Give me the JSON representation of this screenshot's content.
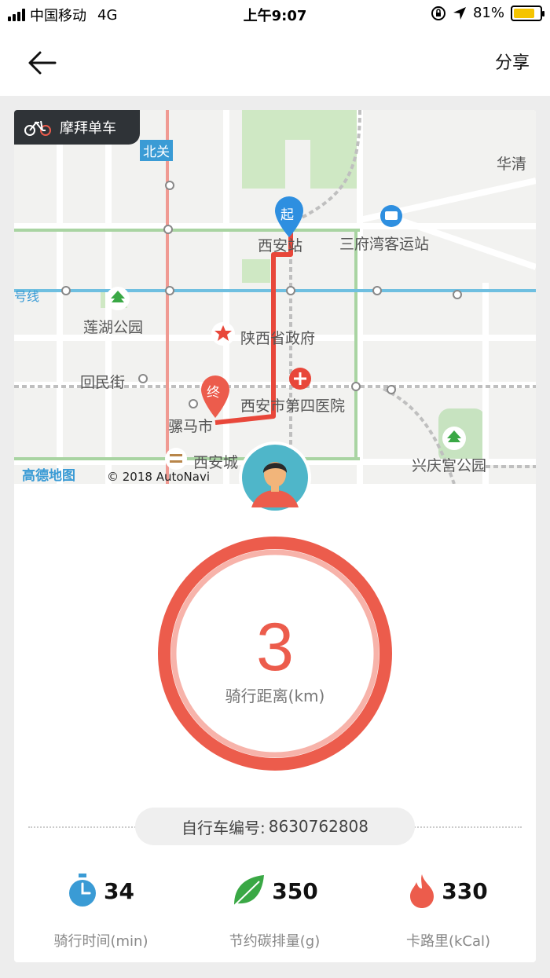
{
  "status_bar": {
    "carrier": "中国移动",
    "network": "4G",
    "time": "上午9:07",
    "battery": "81%",
    "battery_level": 0.81
  },
  "nav": {
    "share_label": "分享"
  },
  "map": {
    "brand": "摩拜单车",
    "labels": {
      "beiguan": "北关",
      "huaqing": "华清",
      "xian_station": "西安站",
      "sanfu": "三府湾客运站",
      "line_suffix": "号线",
      "lianhu": "莲湖公园",
      "shaanxi_gov": "陕西省政府",
      "huimin": "回民街",
      "hospital": "西安市第四医院",
      "luomashi": "骡马市",
      "xian_cheng": "西安城",
      "xingqing": "兴庆宫公园",
      "start_marker": "起",
      "end_marker": "终"
    },
    "amap_logo": "高德地图",
    "copyright": "© 2018 AutoNavi"
  },
  "ride": {
    "distance": "3",
    "distance_label": "骑行距离",
    "distance_unit": "(km)",
    "bike_label": "自行车编号:",
    "bike_number": "8630762808"
  },
  "stats": [
    {
      "icon": "stopwatch-icon",
      "value": "34",
      "label": "骑行时间(min)"
    },
    {
      "icon": "leaf-icon",
      "value": "350",
      "label": "节约碳排量(g)"
    },
    {
      "icon": "flame-icon",
      "value": "330",
      "label": "卡路里(kCal)"
    }
  ],
  "colors": {
    "accent": "#ec5c4c",
    "route": "#e8473a",
    "brand_bg": "#2f3337",
    "stopwatch": "#3a9bd5",
    "leaf": "#3aa845",
    "flame": "#ec5c4c"
  }
}
